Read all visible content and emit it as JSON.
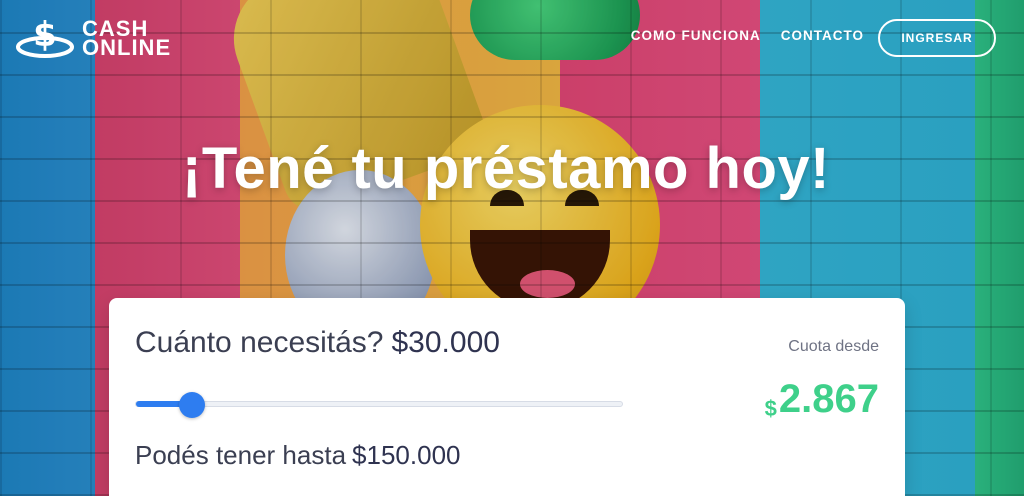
{
  "brand": {
    "logo_top": "CASH",
    "logo_bottom": "ONLINE"
  },
  "nav": {
    "links": [
      "COMO FUNCIONA",
      "CONTACTO"
    ],
    "ingresar": "INGRESAR"
  },
  "hero": {
    "headline": "¡Tené tu préstamo hoy!"
  },
  "calculator": {
    "question": "Cuánto necesitás?",
    "amount": "$30.000",
    "slider_fraction": 0.2,
    "limit_label": "Podés tener hasta",
    "limit_amount": "$150.000",
    "cuota_label": "Cuota desde",
    "cuota_currency": "$",
    "cuota_value": "2.867"
  },
  "colors": {
    "accent_blue": "#2e7df0",
    "cuota_green": "#3ed08a"
  }
}
